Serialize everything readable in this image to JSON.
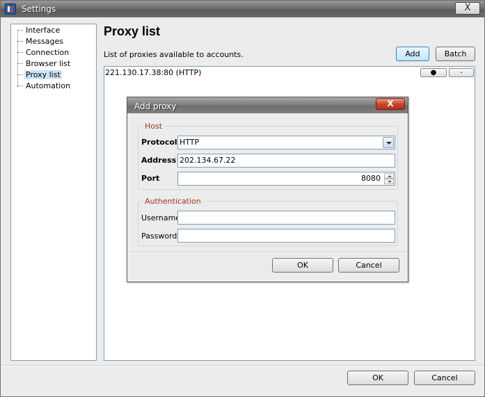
{
  "window": {
    "title": "Settings",
    "close_glyph": "X"
  },
  "tree": {
    "items": [
      {
        "label": "Interface"
      },
      {
        "label": "Messages"
      },
      {
        "label": "Connection"
      },
      {
        "label": "Browser list"
      },
      {
        "label": "Proxy list"
      },
      {
        "label": "Automation"
      }
    ],
    "selected": "Proxy list"
  },
  "panel": {
    "title": "Proxy list",
    "description": "List of proxies available to accounts.",
    "add_label": "Add",
    "batch_label": "Batch",
    "proxies": [
      {
        "text": "221.130.17.38:80 (HTTP)",
        "dot_label": "●",
        "remove_label": "-"
      }
    ]
  },
  "dialog": {
    "title": "Add proxy",
    "close_glyph": "X",
    "host": {
      "legend": "Host",
      "protocol_label": "Protocol",
      "protocol_value": "HTTP",
      "address_label": "Address",
      "address_value": "202.134.67.22",
      "port_label": "Port",
      "port_value": "8080"
    },
    "auth": {
      "legend": "Authentication",
      "username_label": "Username",
      "username_value": "",
      "password_label": "Password",
      "password_value": ""
    },
    "ok_label": "OK",
    "cancel_label": "Cancel"
  },
  "footer": {
    "ok_label": "OK",
    "cancel_label": "Cancel"
  },
  "colors": {
    "accent": "#3c7fb1",
    "legend": "#a0341e",
    "selection": "#cde4f7"
  },
  "icons": [
    "app-icon",
    "close-icon",
    "dropdown-arrow-icon",
    "spin-up-icon",
    "spin-down-icon"
  ]
}
